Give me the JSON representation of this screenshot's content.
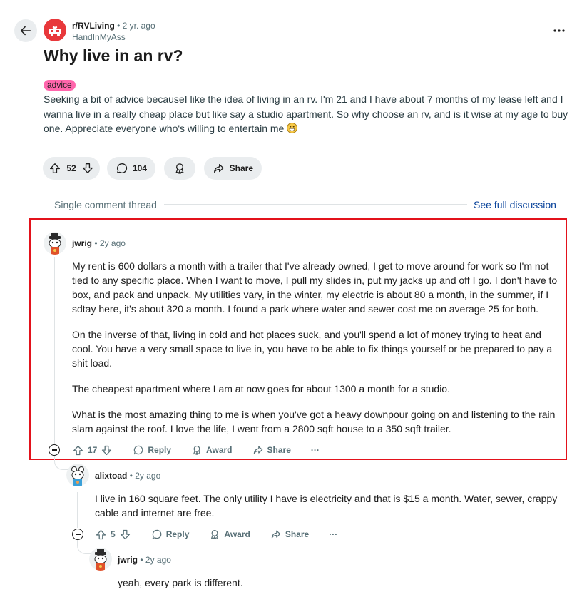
{
  "post": {
    "subreddit": "r/RVLiving",
    "age": "• 2 yr. ago",
    "author": "HandInMyAss",
    "title": "Why live in an rv?",
    "flair": "advice",
    "body": "Seeking a bit of advice becauseI like the idea of living in an rv. I'm 21 and I have about 7 months of my lease left and I wanna live in a really cheap place but like say a studio apartment. So why choose an rv, and is it wise at my age to buy one. Appreciate everyone who's willing to entertain me",
    "votes": "52",
    "comments": "104",
    "share_label": "Share"
  },
  "thread": {
    "label": "Single comment thread",
    "see_full": "See full discussion"
  },
  "comments": [
    {
      "user": "jwrig",
      "age": "• 2y ago",
      "paragraphs": [
        "My rent is 600 dollars a month with a trailer that I've already owned, I get to move around for work so I'm not tied to any specific place. When I want to move, I pull my slides in, put my jacks up and off I go. I don't have to box, and pack and unpack. My utilities vary, in the winter, my electric is about 80 a month, in the summer, if I sdtay here, it's about 320 a month. I found a park where water and sewer cost me on average 25 for both.",
        "On the inverse of that, living in cold and hot places suck, and you'll spend a lot of money trying to heat and cool. You have a very small space to live in, you have to be able to fix things yourself or be prepared to pay a shit load.",
        "The cheapest apartment where I am at now goes for about 1300 a month for a studio.",
        "What is the most amazing thing to me is when you've got a heavy downpour going on and listening to the rain slam against the roof. I love the life, I went from a 2800 sqft house to a 350 sqft trailer."
      ],
      "votes": "17"
    },
    {
      "user": "alixtoad",
      "age": "• 2y ago",
      "paragraphs": [
        "I live in 160 square feet. The only utility I have is electricity and that is $15 a month. Water, sewer, crappy cable and internet are free."
      ],
      "votes": "5"
    },
    {
      "user": "jwrig",
      "age": "• 2y ago",
      "paragraphs": [
        "yeah, every park is different."
      ]
    }
  ],
  "actions": {
    "reply": "Reply",
    "award": "Award",
    "share": "Share",
    "more": "···"
  },
  "colors": {
    "highlight": "#e3121b",
    "flair": "#ff66ac",
    "link": "#0a449b",
    "pill_bg": "#eaedef"
  }
}
